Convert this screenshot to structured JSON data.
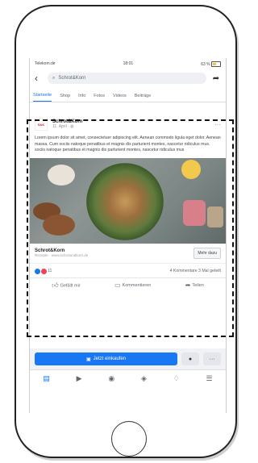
{
  "status": {
    "carrier": "Telekom.de",
    "time": "18:01",
    "battery": "63 %"
  },
  "search": {
    "query": "Schrot&Korn"
  },
  "tabs": [
    "Startseite",
    "Shop",
    "Info",
    "Fotos",
    "Videos",
    "Beiträge"
  ],
  "post": {
    "page_name": "Schrot&Korn",
    "date": "11. April",
    "avatar_text": "S&K",
    "text": "Lorem ipsum dolor sit amet, consectetuer adipiscing elit. Aenean commodo ligula eget dolor. Aenean massa. Cum sociis natoque penatibus et magnis dis parturient montes, nascetur ridiculus mus. sociis natoque penatibus et magnis dis parturient montes, nascetur ridiculus mus"
  },
  "cta": {
    "name": "Schrot&Korn",
    "subtitle": "Rezepte · www.schrotundkorn.de",
    "button": "Mehr dazu"
  },
  "stats": {
    "reactions": "11",
    "comments_shares": "4 Kommentare  3 Mal geteilt"
  },
  "actions": {
    "like": "Gefällt mir",
    "comment": "Kommentieren",
    "share": "Teilen"
  },
  "buy": {
    "label": "Jetzt einkaufen"
  },
  "colors": {
    "accent": "#1877f2",
    "like": "#1877f2",
    "love": "#f33e58"
  }
}
